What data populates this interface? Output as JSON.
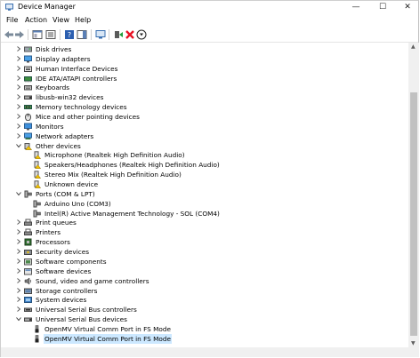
{
  "window": {
    "title": "Device Manager",
    "minimize_icon": "—",
    "maximize_icon": "☐",
    "close_icon": "✕"
  },
  "menu": [
    "File",
    "Action",
    "View",
    "Help"
  ],
  "tree": [
    {
      "label": "Disk drives",
      "depth": 0,
      "expanded": false,
      "icon": "disk-icon"
    },
    {
      "label": "Display adapters",
      "depth": 0,
      "expanded": false,
      "icon": "display-icon"
    },
    {
      "label": "Human Interface Devices",
      "depth": 0,
      "expanded": false,
      "icon": "hid-icon"
    },
    {
      "label": "IDE ATA/ATAPI controllers",
      "depth": 0,
      "expanded": false,
      "icon": "ide-icon"
    },
    {
      "label": "Keyboards",
      "depth": 0,
      "expanded": false,
      "icon": "keyboard-icon"
    },
    {
      "label": "libusb-win32 devices",
      "depth": 0,
      "expanded": false,
      "icon": "usb-device-icon"
    },
    {
      "label": "Memory technology devices",
      "depth": 0,
      "expanded": false,
      "icon": "memory-icon"
    },
    {
      "label": "Mice and other pointing devices",
      "depth": 0,
      "expanded": false,
      "icon": "mouse-icon"
    },
    {
      "label": "Monitors",
      "depth": 0,
      "expanded": false,
      "icon": "monitor-icon"
    },
    {
      "label": "Network adapters",
      "depth": 0,
      "expanded": false,
      "icon": "network-icon"
    },
    {
      "label": "Other devices",
      "depth": 0,
      "expanded": true,
      "icon": "other-device-icon"
    },
    {
      "label": "Microphone (Realtek High Definition Audio)",
      "depth": 1,
      "icon": "unknown-device-icon"
    },
    {
      "label": "Speakers/Headphones (Realtek High Definition Audio)",
      "depth": 1,
      "icon": "unknown-device-icon"
    },
    {
      "label": "Stereo Mix (Realtek High Definition Audio)",
      "depth": 1,
      "icon": "unknown-device-icon"
    },
    {
      "label": "Unknown device",
      "depth": 1,
      "icon": "unknown-device-icon"
    },
    {
      "label": "Ports (COM & LPT)",
      "depth": 0,
      "expanded": true,
      "icon": "port-icon"
    },
    {
      "label": "Arduino Uno (COM3)",
      "depth": 1,
      "icon": "port-icon"
    },
    {
      "label": "Intel(R) Active Management Technology - SOL (COM4)",
      "depth": 1,
      "icon": "port-icon"
    },
    {
      "label": "Print queues",
      "depth": 0,
      "expanded": false,
      "icon": "printer-icon"
    },
    {
      "label": "Printers",
      "depth": 0,
      "expanded": false,
      "icon": "printer-icon"
    },
    {
      "label": "Processors",
      "depth": 0,
      "expanded": false,
      "icon": "processor-icon"
    },
    {
      "label": "Security devices",
      "depth": 0,
      "expanded": false,
      "icon": "security-icon"
    },
    {
      "label": "Software components",
      "depth": 0,
      "expanded": false,
      "icon": "software-component-icon"
    },
    {
      "label": "Software devices",
      "depth": 0,
      "expanded": false,
      "icon": "software-device-icon"
    },
    {
      "label": "Sound, video and game controllers",
      "depth": 0,
      "expanded": false,
      "icon": "sound-icon"
    },
    {
      "label": "Storage controllers",
      "depth": 0,
      "expanded": false,
      "icon": "storage-icon"
    },
    {
      "label": "System devices",
      "depth": 0,
      "expanded": false,
      "icon": "system-icon"
    },
    {
      "label": "Universal Serial Bus controllers",
      "depth": 0,
      "expanded": false,
      "icon": "usb-controller-icon"
    },
    {
      "label": "Universal Serial Bus devices",
      "depth": 0,
      "expanded": true,
      "icon": "usb-device-icon"
    },
    {
      "label": "OpenMV Virtual Comm Port in FS Mode",
      "depth": 1,
      "icon": "usb-plug-icon"
    },
    {
      "label": "OpenMV Virtual Comm Port in FS Mode",
      "depth": 1,
      "icon": "usb-plug-icon",
      "selected": true
    }
  ],
  "colors": {
    "selection": "#cce8ff",
    "warning": "#f2c200",
    "remove": "#e81123",
    "update": "#1e9e3a"
  }
}
